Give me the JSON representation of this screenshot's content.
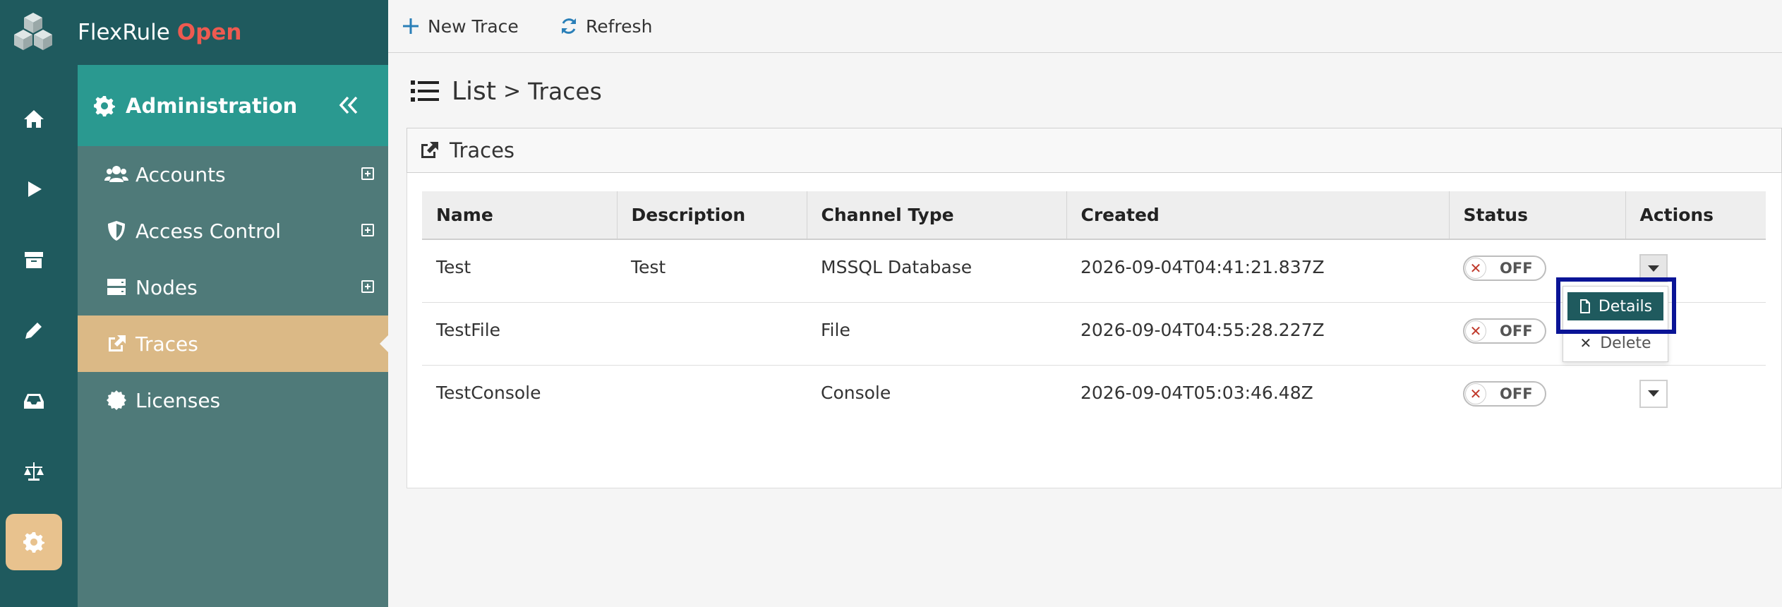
{
  "brand": {
    "name": "FlexRule",
    "accent": "Open",
    "accent_color": "#ee5a50"
  },
  "colors": {
    "rail": "#1f5a5e",
    "sidebar": "#4f7a79",
    "sidebar_header": "#2a9990",
    "active_item": "#dbb986",
    "highlight": "#0a1496"
  },
  "rail": {
    "items": [
      {
        "icon": "home-icon"
      },
      {
        "icon": "play-icon"
      },
      {
        "icon": "archive-icon"
      },
      {
        "icon": "pencil-icon"
      },
      {
        "icon": "inbox-icon"
      },
      {
        "icon": "scale-icon"
      },
      {
        "icon": "gear-icon",
        "active": true
      }
    ]
  },
  "sidebar": {
    "title": "Administration",
    "items": [
      {
        "label": "Accounts",
        "icon": "users-icon",
        "expandable": true
      },
      {
        "label": "Access Control",
        "icon": "shield-icon",
        "expandable": true
      },
      {
        "label": "Nodes",
        "icon": "server-icon",
        "expandable": true
      },
      {
        "label": "Traces",
        "icon": "external-link-icon",
        "active": true
      },
      {
        "label": "Licenses",
        "icon": "certificate-icon"
      }
    ]
  },
  "toolbar": {
    "new_trace": "New Trace",
    "refresh": "Refresh"
  },
  "page": {
    "title": "List",
    "separator": ">",
    "crumb": "Traces"
  },
  "panel": {
    "title": "Traces"
  },
  "table": {
    "columns": [
      "Name",
      "Description",
      "Channel Type",
      "Created",
      "Status",
      "Actions"
    ],
    "rows": [
      {
        "name": "Test",
        "description": "Test",
        "channel_type": "MSSQL Database",
        "created": "2026-09-04T04:41:21.837Z",
        "status": "OFF"
      },
      {
        "name": "TestFile",
        "description": "",
        "channel_type": "File",
        "created": "2026-09-04T04:55:28.227Z",
        "status": "OFF"
      },
      {
        "name": "TestConsole",
        "description": "",
        "channel_type": "Console",
        "created": "2026-09-04T05:03:46.48Z",
        "status": "OFF"
      }
    ]
  },
  "actions_menu": {
    "details": "Details",
    "delete": "Delete",
    "delete_glyph": "✕",
    "toggle_glyph": "✕"
  }
}
